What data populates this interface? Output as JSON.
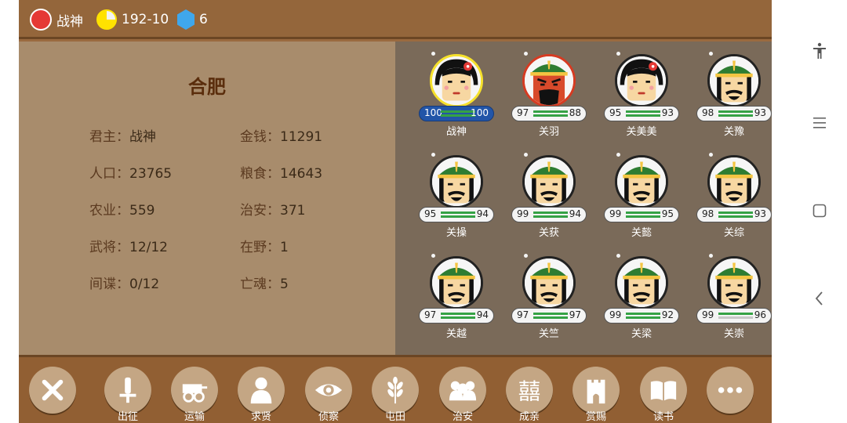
{
  "topbar": {
    "ruler": "战神",
    "turn": "192-10",
    "gems": "6"
  },
  "city": {
    "name": "合肥",
    "info": [
      {
        "label": "君主：",
        "value": "战神"
      },
      {
        "label": "金钱：",
        "value": "11291"
      },
      {
        "label": "人口：",
        "value": "23765"
      },
      {
        "label": "粮食：",
        "value": "14643"
      },
      {
        "label": "农业：",
        "value": "559"
      },
      {
        "label": "治安：",
        "value": "371"
      },
      {
        "label": "武将：",
        "value": "12/12"
      },
      {
        "label": "在野：",
        "value": "1"
      },
      {
        "label": "间谍：",
        "value": "0/12"
      },
      {
        "label": "亡魂：",
        "value": "5"
      }
    ]
  },
  "generals": [
    {
      "name": "战神",
      "a": "100",
      "b": "100"
    },
    {
      "name": "关羽",
      "a": "97",
      "b": "88"
    },
    {
      "name": "关美美",
      "a": "95",
      "b": "93"
    },
    {
      "name": "关豫",
      "a": "98",
      "b": "93"
    },
    {
      "name": "关操",
      "a": "95",
      "b": "94"
    },
    {
      "name": "关获",
      "a": "99",
      "b": "94"
    },
    {
      "name": "关懿",
      "a": "99",
      "b": "95"
    },
    {
      "name": "关综",
      "a": "98",
      "b": "93"
    },
    {
      "name": "关越",
      "a": "97",
      "b": "94"
    },
    {
      "name": "关竺",
      "a": "97",
      "b": "97"
    },
    {
      "name": "关梁",
      "a": "99",
      "b": "92"
    },
    {
      "name": "关崇",
      "a": "99",
      "b": "96"
    }
  ],
  "toolbar": [
    {
      "label": "",
      "icon": "close-icon"
    },
    {
      "label": "出征",
      "icon": "sword-icon"
    },
    {
      "label": "运输",
      "icon": "cart-icon"
    },
    {
      "label": "求贤",
      "icon": "person-icon"
    },
    {
      "label": "侦察",
      "icon": "eye-icon"
    },
    {
      "label": "屯田",
      "icon": "wheat-icon"
    },
    {
      "label": "治安",
      "icon": "crowd-icon"
    },
    {
      "label": "成亲",
      "icon": "double-happiness-icon"
    },
    {
      "label": "赏赐",
      "icon": "tower-icon"
    },
    {
      "label": "读书",
      "icon": "book-icon"
    },
    {
      "label": "",
      "icon": "more-icon"
    }
  ],
  "colors": {
    "topbar": "#94663b",
    "city_panel": "#a88c6c",
    "generals_panel": "#7a6a59",
    "toolbar": "#915f33",
    "stat_bar_green": "#35a245"
  }
}
